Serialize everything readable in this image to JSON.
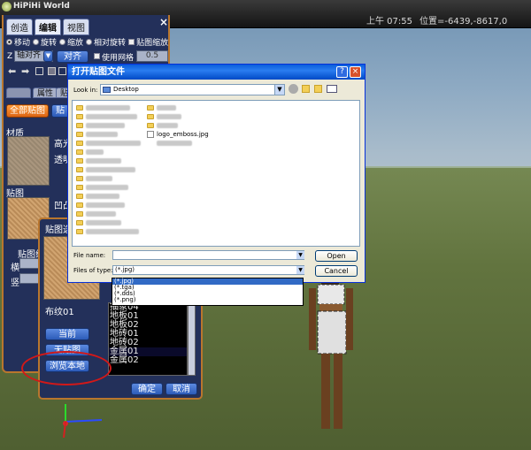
{
  "app": {
    "name": "HiPiHi World"
  },
  "status": {
    "time": "上午 07:55",
    "position": "位置=-6439,-8617,0"
  },
  "editor": {
    "tabs": [
      "创造",
      "编辑",
      "视图"
    ],
    "close_icon": "×",
    "modes": [
      "移动",
      "旋转",
      "缩放",
      "相对旋转",
      "贴图缩放"
    ],
    "axis_prefix": "Z",
    "axis_value": "轴对齐",
    "align_button": "对齐",
    "grid_label": "使用网格",
    "grid_value": "0.5",
    "subtabs": [
      "属性",
      "贴"
    ],
    "all_tex_button": "全部贴图",
    "all_tex_button2": "贴",
    "material_label": "材质",
    "highlight_label": "高光",
    "transparency_label": "透明",
    "texture_label": "贴图",
    "bump_label": "凹凸",
    "tex_scale_label": "贴图缩",
    "horizontal_label": "横",
    "vertical_label": "竖"
  },
  "texture_dialog": {
    "title": "贴图选",
    "current_texture": "布纹01",
    "current_button": "当前",
    "none_button": "无贴图",
    "browse_button": "浏览本地",
    "ok_button": "确定",
    "cancel_button": "取消",
    "list": [
      "抽象04",
      "地板01",
      "地板02",
      "地砖01",
      "地砖02",
      "金属01",
      "金属02"
    ],
    "selected_index": 5
  },
  "file_dialog": {
    "title": "打开贴图文件",
    "help_icon": "?",
    "close_icon": "×",
    "look_in_label": "Look in:",
    "look_in_value": "Desktop",
    "visible_file": "logo_emboss.jpg",
    "file_name_label": "File name:",
    "file_name_value": "",
    "file_type_label": "Files of type:",
    "file_type_value": "(*.jpg)",
    "open_button": "Open",
    "cancel_button": "Cancel",
    "type_options": [
      "(*.jpg)",
      "(*.tga)",
      "(*.dds)",
      "(*.png)"
    ],
    "selected_type_index": 0
  }
}
